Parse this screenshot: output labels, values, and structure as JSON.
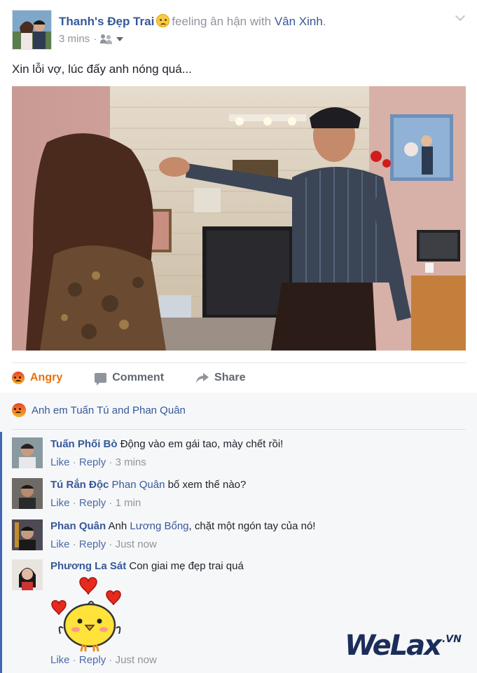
{
  "post": {
    "author": "Thanh's Đẹp Trai",
    "feeling": "feeling ân hận with",
    "tagged": "Vân Xinh",
    "tagged_suffix": ".",
    "time": "3 mins",
    "privacy_icon": "friends-icon",
    "text": "Xin lỗi vợ, lúc đấy anh nóng quá..."
  },
  "actions": {
    "reaction_label": "Angry",
    "comment_label": "Comment",
    "share_label": "Share"
  },
  "reactions_summary": "Anh em Tuấn Tú and Phan Quân",
  "comments": [
    {
      "author": "Tuấn Phối Bò",
      "mention": "",
      "text": "Động vào em gái tao, mày chết rồi!",
      "like": "Like",
      "reply": "Reply",
      "time": "3 mins"
    },
    {
      "author": "Tú Rắn Độc",
      "mention": "Phan Quân",
      "text": "bố xem thế nào?",
      "like": "Like",
      "reply": "Reply",
      "time": "1 min"
    },
    {
      "author": "Phan Quân",
      "mention": "Lương Bổng",
      "pre_mention": "Anh",
      "text": ", chặt một ngón tay của nó!",
      "like": "Like",
      "reply": "Reply",
      "time": "Just now"
    },
    {
      "author": "Phương La Sát",
      "mention": "",
      "text": "Con giai mẹ đẹp trai quá",
      "like": "Like",
      "reply": "Reply",
      "time": "Just now"
    }
  ],
  "watermark": {
    "main": "WeLax",
    "sub": ".VN"
  },
  "colors": {
    "link": "#365899",
    "angry": "#e9710f",
    "meta": "#90949c",
    "accent_bar": "#4267b2"
  }
}
